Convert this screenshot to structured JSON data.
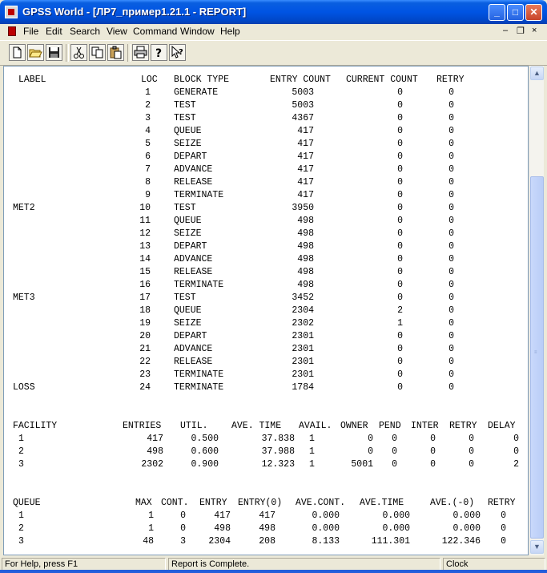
{
  "window": {
    "title": "GPSS World - [ЛР7_пример1.21.1  - REPORT]"
  },
  "menu": [
    "File",
    "Edit",
    "Search",
    "View",
    "Command",
    "Window",
    "Help"
  ],
  "toolbar_icons": [
    "new-file-icon",
    "open-folder-icon",
    "save-icon",
    "cut-icon",
    "copy-icon",
    "paste-icon",
    "print-icon",
    "help-icon",
    "context-help-icon"
  ],
  "blocks": {
    "headers": [
      "LABEL",
      "LOC",
      "BLOCK TYPE",
      "ENTRY COUNT",
      "CURRENT COUNT",
      "RETRY"
    ],
    "rows": [
      [
        "",
        "1",
        "GENERATE",
        "5003",
        "0",
        "0"
      ],
      [
        "",
        "2",
        "TEST",
        "5003",
        "0",
        "0"
      ],
      [
        "",
        "3",
        "TEST",
        "4367",
        "0",
        "0"
      ],
      [
        "",
        "4",
        "QUEUE",
        "417",
        "0",
        "0"
      ],
      [
        "",
        "5",
        "SEIZE",
        "417",
        "0",
        "0"
      ],
      [
        "",
        "6",
        "DEPART",
        "417",
        "0",
        "0"
      ],
      [
        "",
        "7",
        "ADVANCE",
        "417",
        "0",
        "0"
      ],
      [
        "",
        "8",
        "RELEASE",
        "417",
        "0",
        "0"
      ],
      [
        "",
        "9",
        "TERMINATE",
        "417",
        "0",
        "0"
      ],
      [
        "MET2",
        "10",
        "TEST",
        "3950",
        "0",
        "0"
      ],
      [
        "",
        "11",
        "QUEUE",
        "498",
        "0",
        "0"
      ],
      [
        "",
        "12",
        "SEIZE",
        "498",
        "0",
        "0"
      ],
      [
        "",
        "13",
        "DEPART",
        "498",
        "0",
        "0"
      ],
      [
        "",
        "14",
        "ADVANCE",
        "498",
        "0",
        "0"
      ],
      [
        "",
        "15",
        "RELEASE",
        "498",
        "0",
        "0"
      ],
      [
        "",
        "16",
        "TERMINATE",
        "498",
        "0",
        "0"
      ],
      [
        "MET3",
        "17",
        "TEST",
        "3452",
        "0",
        "0"
      ],
      [
        "",
        "18",
        "QUEUE",
        "2304",
        "2",
        "0"
      ],
      [
        "",
        "19",
        "SEIZE",
        "2302",
        "1",
        "0"
      ],
      [
        "",
        "20",
        "DEPART",
        "2301",
        "0",
        "0"
      ],
      [
        "",
        "21",
        "ADVANCE",
        "2301",
        "0",
        "0"
      ],
      [
        "",
        "22",
        "RELEASE",
        "2301",
        "0",
        "0"
      ],
      [
        "",
        "23",
        "TERMINATE",
        "2301",
        "0",
        "0"
      ],
      [
        "LOSS",
        "24",
        "TERMINATE",
        "1784",
        "0",
        "0"
      ]
    ]
  },
  "facility": {
    "headers": [
      "FACILITY",
      "ENTRIES",
      "UTIL.",
      "AVE. TIME",
      "AVAIL.",
      "OWNER",
      "PEND",
      "INTER",
      "RETRY",
      "DELAY"
    ],
    "rows": [
      [
        "1",
        "417",
        "0.500",
        "37.838",
        "1",
        "0",
        "0",
        "0",
        "0",
        "0"
      ],
      [
        "2",
        "498",
        "0.600",
        "37.988",
        "1",
        "0",
        "0",
        "0",
        "0",
        "0"
      ],
      [
        "3",
        "2302",
        "0.900",
        "12.323",
        "1",
        "5001",
        "0",
        "0",
        "0",
        "2"
      ]
    ]
  },
  "queue": {
    "headers": [
      "QUEUE",
      "MAX",
      "CONT.",
      "ENTRY",
      "ENTRY(0)",
      "AVE.CONT.",
      "AVE.TIME",
      "AVE.(-0)",
      "RETRY"
    ],
    "rows": [
      [
        "1",
        "1",
        "0",
        "417",
        "417",
        "0.000",
        "0.000",
        "0.000",
        "0"
      ],
      [
        "2",
        "1",
        "0",
        "498",
        "498",
        "0.000",
        "0.000",
        "0.000",
        "0"
      ],
      [
        "3",
        "48",
        "3",
        "2304",
        "208",
        "8.133",
        "111.301",
        "122.346",
        "0"
      ]
    ]
  },
  "status": {
    "help": "For Help, press F1",
    "message": "Report is Complete.",
    "clock": "Clock"
  }
}
